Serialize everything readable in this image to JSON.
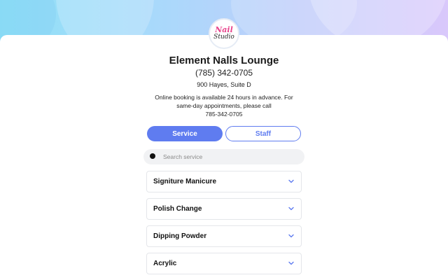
{
  "header": {
    "logo_line1": "Nail",
    "logo_line2": "Studio"
  },
  "salon": {
    "name": "Element Nalls Lounge",
    "phone": "(785) 342-0705",
    "address": "900 Hayes, Suite D",
    "note": "Online booking is available 24 hours in advance. For same-day appointments, please call",
    "call_number": "785-342-0705"
  },
  "tabs": {
    "service": "Service",
    "staff": "Staff",
    "active": "Service"
  },
  "search": {
    "placeholder": "Search service",
    "value": ""
  },
  "services": [
    {
      "label": "Signiture Manicure",
      "icon": "chevron-down-icon"
    },
    {
      "label": "Polish Change",
      "icon": "chevron-down-icon"
    },
    {
      "label": "Dipping Powder",
      "icon": "chevron-down-icon"
    },
    {
      "label": "Acrylic",
      "icon": "chevron-down-icon"
    }
  ],
  "colors": {
    "accent": "#5f7cf0",
    "logo_pink": "#e8458c"
  }
}
